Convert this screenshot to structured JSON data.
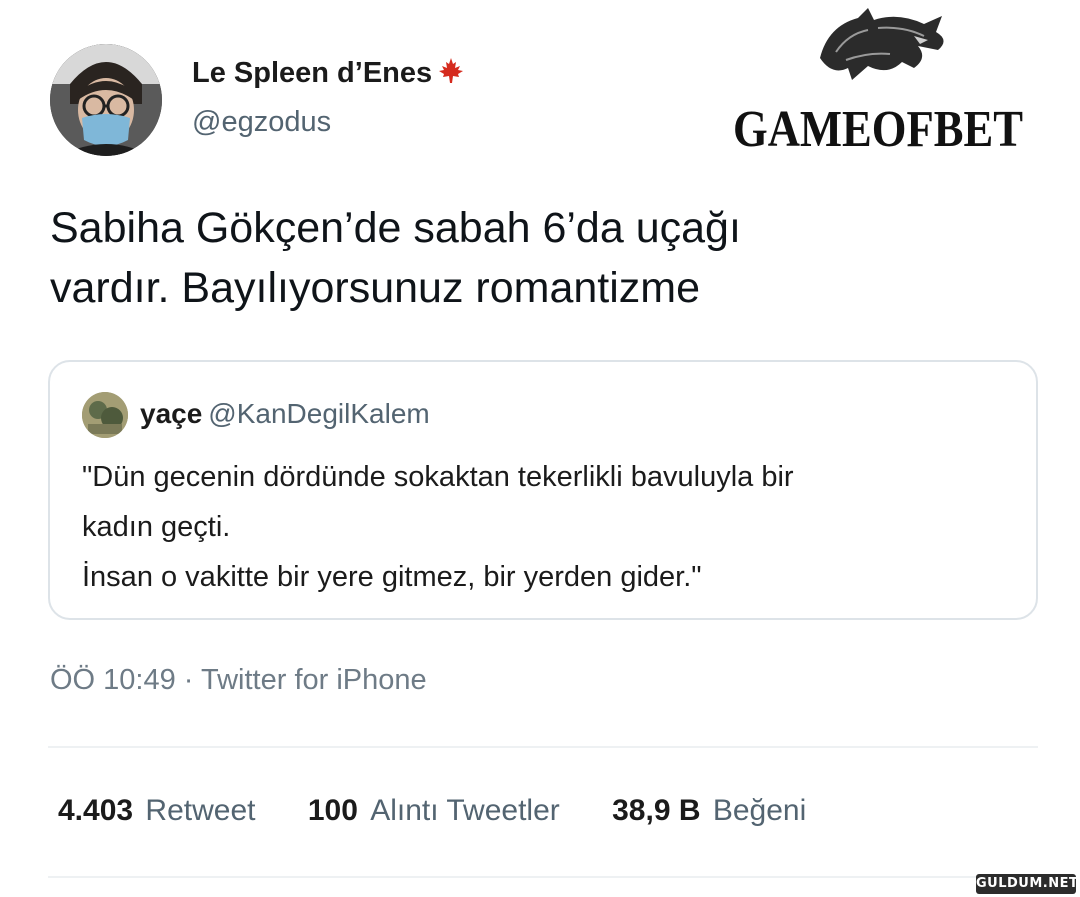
{
  "tweet": {
    "author": {
      "name": "Le Spleen d’Enes",
      "handle": "@egzodus",
      "flag_icon": "maple-leaf-icon"
    },
    "text_lines": [
      "Sabiha Gökçen’de sabah 6’da uçağı",
      "vardır. Bayılıyorsunuz romantizme"
    ],
    "quote": {
      "name": "yaçe",
      "handle": "@KanDegilKalem",
      "text_lines": [
        "\"Dün gecenin dördünde sokaktan tekerlikli bavuluyla bir",
        "kadın geçti.",
        "İnsan o vakitte bir yere gitmez, bir yerden gider.\""
      ]
    },
    "meta": "ÖÖ 10:49 · Twitter for iPhone",
    "stats": [
      {
        "count": "4.403",
        "label": "Retweet"
      },
      {
        "count": "100",
        "label": "Alıntı Tweetler"
      },
      {
        "count": "38,9 B",
        "label": "Beğeni"
      }
    ]
  },
  "overlay_logo": {
    "text": "GAMEOFBET",
    "icon": "wolf-head-icon"
  },
  "watermark": "GULDUM.NET",
  "colors": {
    "text": "#0f1419",
    "secondary": "#536471",
    "border": "#dde3e8",
    "leaf": "#d52b1e"
  }
}
